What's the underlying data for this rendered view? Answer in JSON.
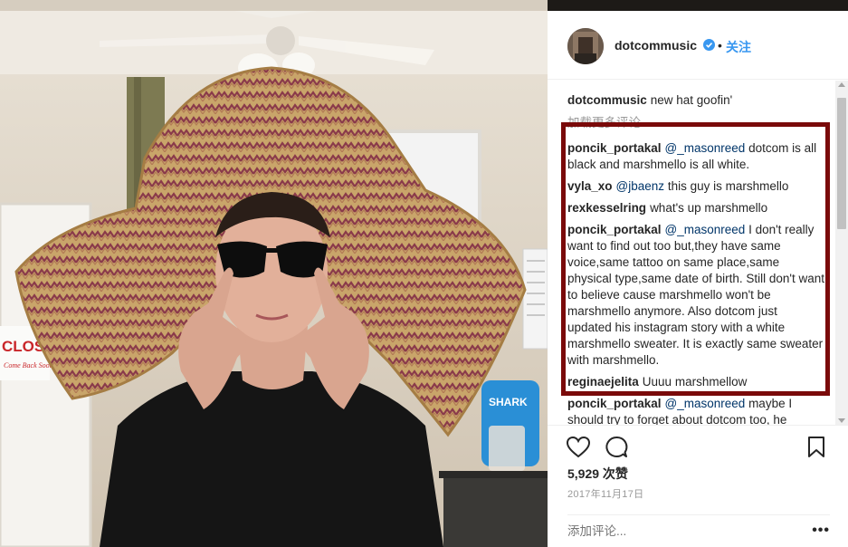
{
  "post": {
    "username": "dotcommusic",
    "separator": "•",
    "follow_label": "关注",
    "caption_user": "dotcommusic",
    "caption_text": "new hat goofin'",
    "load_more": "加载更多评论",
    "likes": "5,929 次赞",
    "date": "2017年11月17日",
    "add_comment_placeholder": "添加评论...",
    "more_options": "•••"
  },
  "photo": {
    "sign_text": "CLOSED",
    "sign_sub": "Come Back Soon",
    "bag_text": "SHARK"
  },
  "comments": [
    {
      "user": "poncik_portakal",
      "mention": "@_masonreed",
      "text": "dotcom is all black and marshmello is all white."
    },
    {
      "user": "vyla_xo",
      "mention": "@jbaenz",
      "text": "this guy is marshmello"
    },
    {
      "user": "rexkesselring",
      "mention": "",
      "text": "what's up marshmello"
    },
    {
      "user": "poncik_portakal",
      "mention": "@_masonreed",
      "text": "I don't really want to find out too but,they have same voice,same tattoo on same place,same physical type,same date of birth. Still don't want to believe cause marshmello won't be marshmello anymore. Also dotcom just updated his instagram story with a white marshmello sweater. It is exactly same sweater with marshmello."
    },
    {
      "user": "reginaejelita",
      "mention": "",
      "text": "Uuuu marshmellow"
    },
    {
      "user": "poncik_portakal",
      "mention": "@_masonreed",
      "text": "maybe I should try to forget about dotcom too, he"
    }
  ],
  "colors": {
    "link": "#3897f0",
    "mention": "#003569",
    "highlight_box": "#7a0a0a",
    "verified_badge": "#3897f0",
    "muted_text": "#999999"
  },
  "icons": [
    "verified-badge-icon",
    "heart-icon",
    "comment-icon",
    "bookmark-icon",
    "more-options-icon"
  ]
}
